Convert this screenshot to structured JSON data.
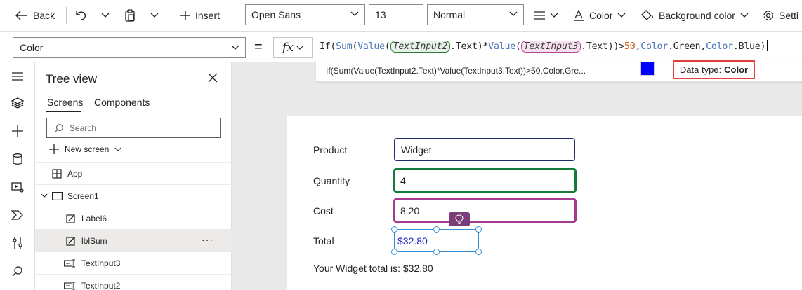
{
  "toolbar": {
    "back_label": "Back",
    "insert_label": "Insert",
    "font": "Open Sans",
    "font_size": "13",
    "font_weight": "Normal",
    "color_label": "Color",
    "bg_color_label": "Background color",
    "settings_label": "Setti"
  },
  "formula_bar": {
    "property": "Color",
    "equals": "=",
    "fx_label": "fx",
    "parts": {
      "p1": "If(",
      "sum": "Sum",
      "p2": "(",
      "value1": "Value",
      "p3": "(",
      "token1": "TextInput2",
      "p4": ".Text)*",
      "value2": "Value",
      "p5": "(",
      "token2": "TextInput3",
      "p6": ".Text))>",
      "num": "50",
      "p7": ",",
      "enum1": "Color",
      "p8": ".Green,",
      "enum2": "Color",
      "p9": ".Blue)"
    }
  },
  "result": {
    "expression": "If(Sum(Value(TextInput2.Text)*Value(TextInput3.Text))>50,Color.Gre...",
    "equals": "=",
    "swatch_color": "#0000ff",
    "data_type_label": "Data type:",
    "data_type_value": "Color"
  },
  "rail": {
    "icons": [
      "hamburger-icon",
      "layers-icon",
      "plus-icon",
      "database-icon",
      "media-icon",
      "power-automate-icon",
      "tools-icon",
      "search-icon"
    ]
  },
  "tree": {
    "title": "Tree view",
    "tabs": {
      "screens": "Screens",
      "components": "Components"
    },
    "search_placeholder": "Search",
    "new_screen": "New screen",
    "items": [
      {
        "label": "App"
      },
      {
        "label": "Screen1"
      },
      {
        "label": "Label6"
      },
      {
        "label": "lblSum"
      },
      {
        "label": "TextInput3"
      },
      {
        "label": "TextInput2"
      }
    ],
    "more": "···"
  },
  "canvas": {
    "product_label": "Product",
    "product_value": "Widget",
    "quantity_label": "Quantity",
    "quantity_value": "4",
    "cost_label": "Cost",
    "cost_value": "8.20",
    "total_label": "Total",
    "total_value": "$32.80",
    "summary": "Your Widget total is: $32.80"
  },
  "colors": {
    "quantity_border": "#137c38",
    "cost_border": "#a53b8c",
    "selection": "#3a8ed3",
    "highlight_box": "#e0413f",
    "bulb": "#7a3d7a"
  }
}
